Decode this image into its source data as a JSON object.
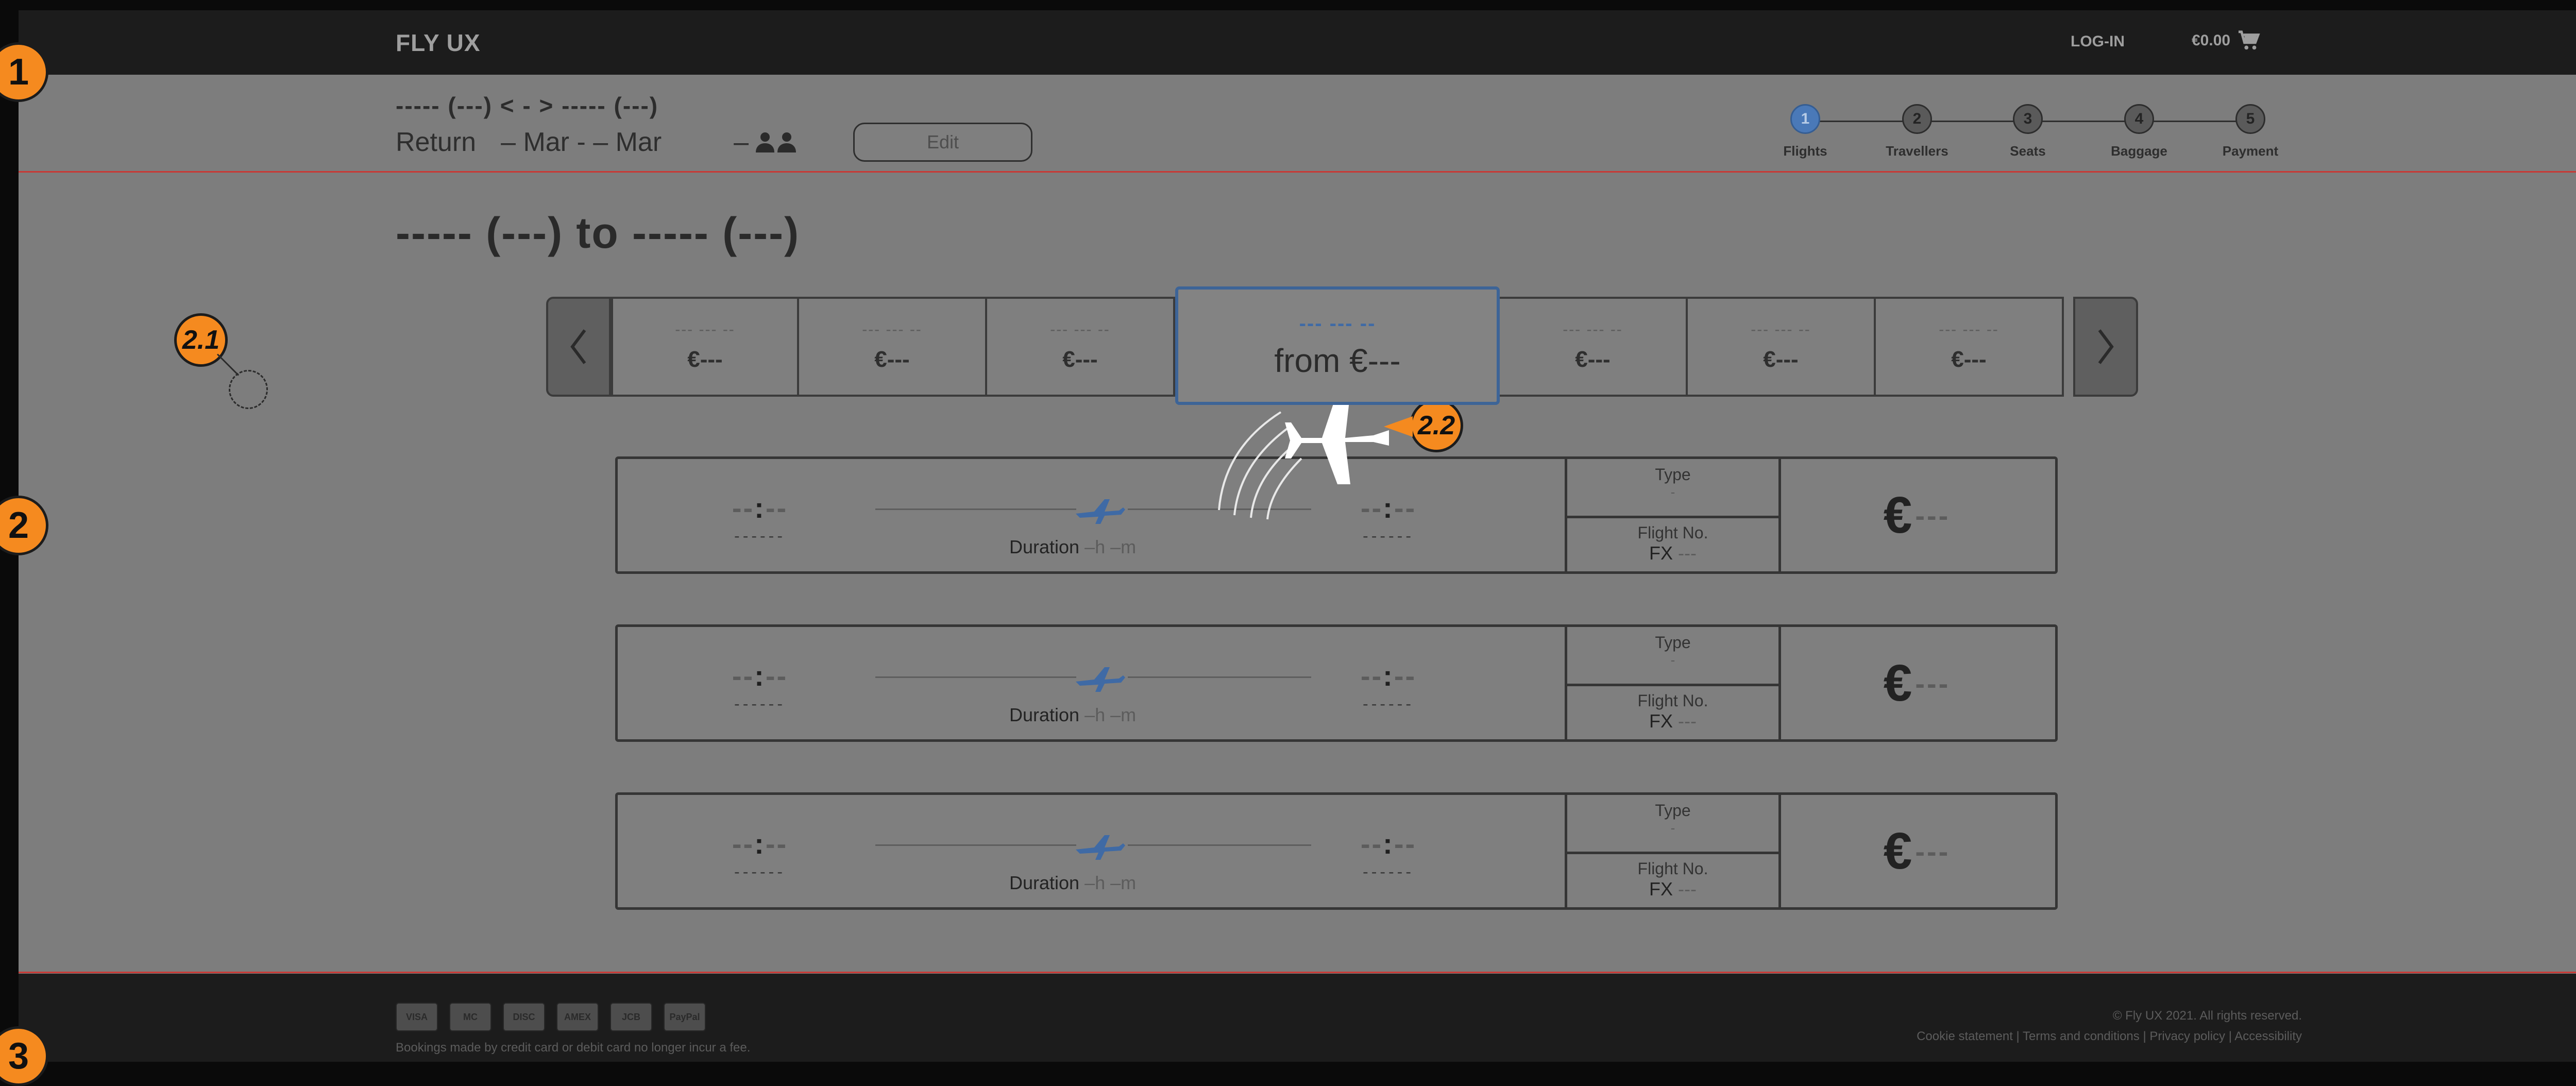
{
  "header": {
    "logo": "FLY UX",
    "login_label": "LOG-IN",
    "cart_total": "€0.00",
    "cart_icon": "shopping-cart-icon"
  },
  "summary": {
    "route": "----- (---) < - > ----- (---)",
    "trip_type": "Return",
    "dates": "– Mar - – Mar",
    "passengers": "–",
    "edit_label": "Edit"
  },
  "stepper": {
    "steps": [
      {
        "number": "1",
        "label": "Flights",
        "active": true
      },
      {
        "number": "2",
        "label": "Travellers",
        "active": false
      },
      {
        "number": "3",
        "label": "Seats",
        "active": false
      },
      {
        "number": "4",
        "label": "Baggage",
        "active": false
      },
      {
        "number": "5",
        "label": "Payment",
        "active": false
      }
    ]
  },
  "heading": "----- (---) to ----- (---)",
  "date_carousel": {
    "dates": [
      {
        "date": "--- --- --",
        "price": "€---"
      },
      {
        "date": "--- --- --",
        "price": "€---"
      },
      {
        "date": "--- --- --",
        "price": "€---"
      },
      {
        "date": "--- --- --",
        "price": "from €---",
        "selected": true
      },
      {
        "date": "--- --- --",
        "price": "€---"
      },
      {
        "date": "--- --- --",
        "price": "€---"
      },
      {
        "date": "--- --- --",
        "price": "€---"
      }
    ]
  },
  "flights": [
    {
      "dep_time_a": "--",
      "dep_time_b": "--",
      "dep_code": "------",
      "arr_time_a": "--",
      "arr_time_b": "--",
      "arr_code": "------",
      "duration_label": "Duration",
      "duration_value": " –h –m",
      "type_label": "Type",
      "type_value": "-",
      "flight_no_label": "Flight No.",
      "flight_no_prefix": "FX",
      "flight_no_value": " ---",
      "price_symbol": "€",
      "price_value": "---"
    },
    {
      "dep_time_a": "--",
      "dep_time_b": "--",
      "dep_code": "------",
      "arr_time_a": "--",
      "arr_time_b": "--",
      "arr_code": "------",
      "duration_label": "Duration",
      "duration_value": " –h –m",
      "type_label": "Type",
      "type_value": "-",
      "flight_no_label": "Flight No.",
      "flight_no_prefix": "FX",
      "flight_no_value": " ---",
      "price_symbol": "€",
      "price_value": "---"
    },
    {
      "dep_time_a": "--",
      "dep_time_b": "--",
      "dep_code": "------",
      "arr_time_a": "--",
      "arr_time_b": "--",
      "arr_code": "------",
      "duration_label": "Duration",
      "duration_value": " –h –m",
      "type_label": "Type",
      "type_value": "-",
      "flight_no_label": "Flight No.",
      "flight_no_prefix": "FX",
      "flight_no_value": " ---",
      "price_symbol": "€",
      "price_value": "---"
    }
  ],
  "annotations": {
    "a1": "1",
    "a2": "2",
    "a3": "3",
    "a21": "2.1",
    "a22": "2.2"
  },
  "footer": {
    "cards": [
      "VISA",
      "MC",
      "DISC",
      "AMEX",
      "JCB",
      "PayPal"
    ],
    "note": "Bookings made by credit card or debit card no longer incur a fee.",
    "copyright": "© Fly UX 2021. All rights reserved.",
    "links": "Cookie statement | Terms and conditions | Privacy policy | Accessibility"
  },
  "colors": {
    "accent": "#4a79b8",
    "annotation": "#f58a1f",
    "section_divider": "#c73a36"
  }
}
